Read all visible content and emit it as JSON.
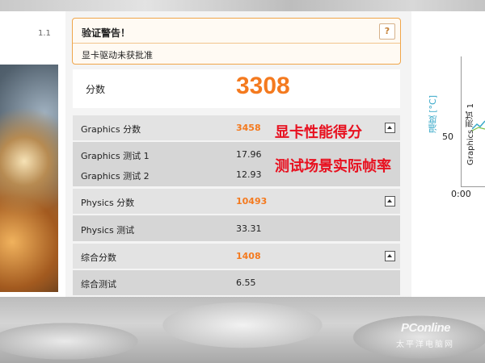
{
  "window": {
    "version": "1.1"
  },
  "warning": {
    "title": "验证警告！",
    "message": "显卡驱动未获批准",
    "help_label": "?"
  },
  "score": {
    "label": "分数",
    "value": "3308"
  },
  "rows": [
    {
      "label": "Graphics 分数",
      "value": "3458",
      "highlight": true
    },
    {
      "label": "Graphics 测试 1",
      "value": "17.96"
    },
    {
      "label": "Graphics 测试 2",
      "value": "12.93"
    },
    {
      "label": "Physics 分数",
      "value": "10493",
      "highlight": true
    },
    {
      "label": "Physics 测试",
      "value": "33.31"
    },
    {
      "label": "综合分数",
      "value": "1408",
      "highlight": true
    },
    {
      "label": "综合测试",
      "value": "6.55"
    }
  ],
  "annotations": {
    "graphics_score": "显卡性能得分",
    "fps": "测试场景实际帧率"
  },
  "chart": {
    "temp_label": "温度 [°C]",
    "series_label": "Graphics 测试 1",
    "tick_50": "50",
    "tick_time": "0:00"
  },
  "watermark": {
    "brand": "PConline",
    "sub": "太平洋电脑网"
  },
  "colors": {
    "accent": "#f47a1f",
    "annotation": "#e8101f",
    "warning_border": "#f0a64a"
  }
}
